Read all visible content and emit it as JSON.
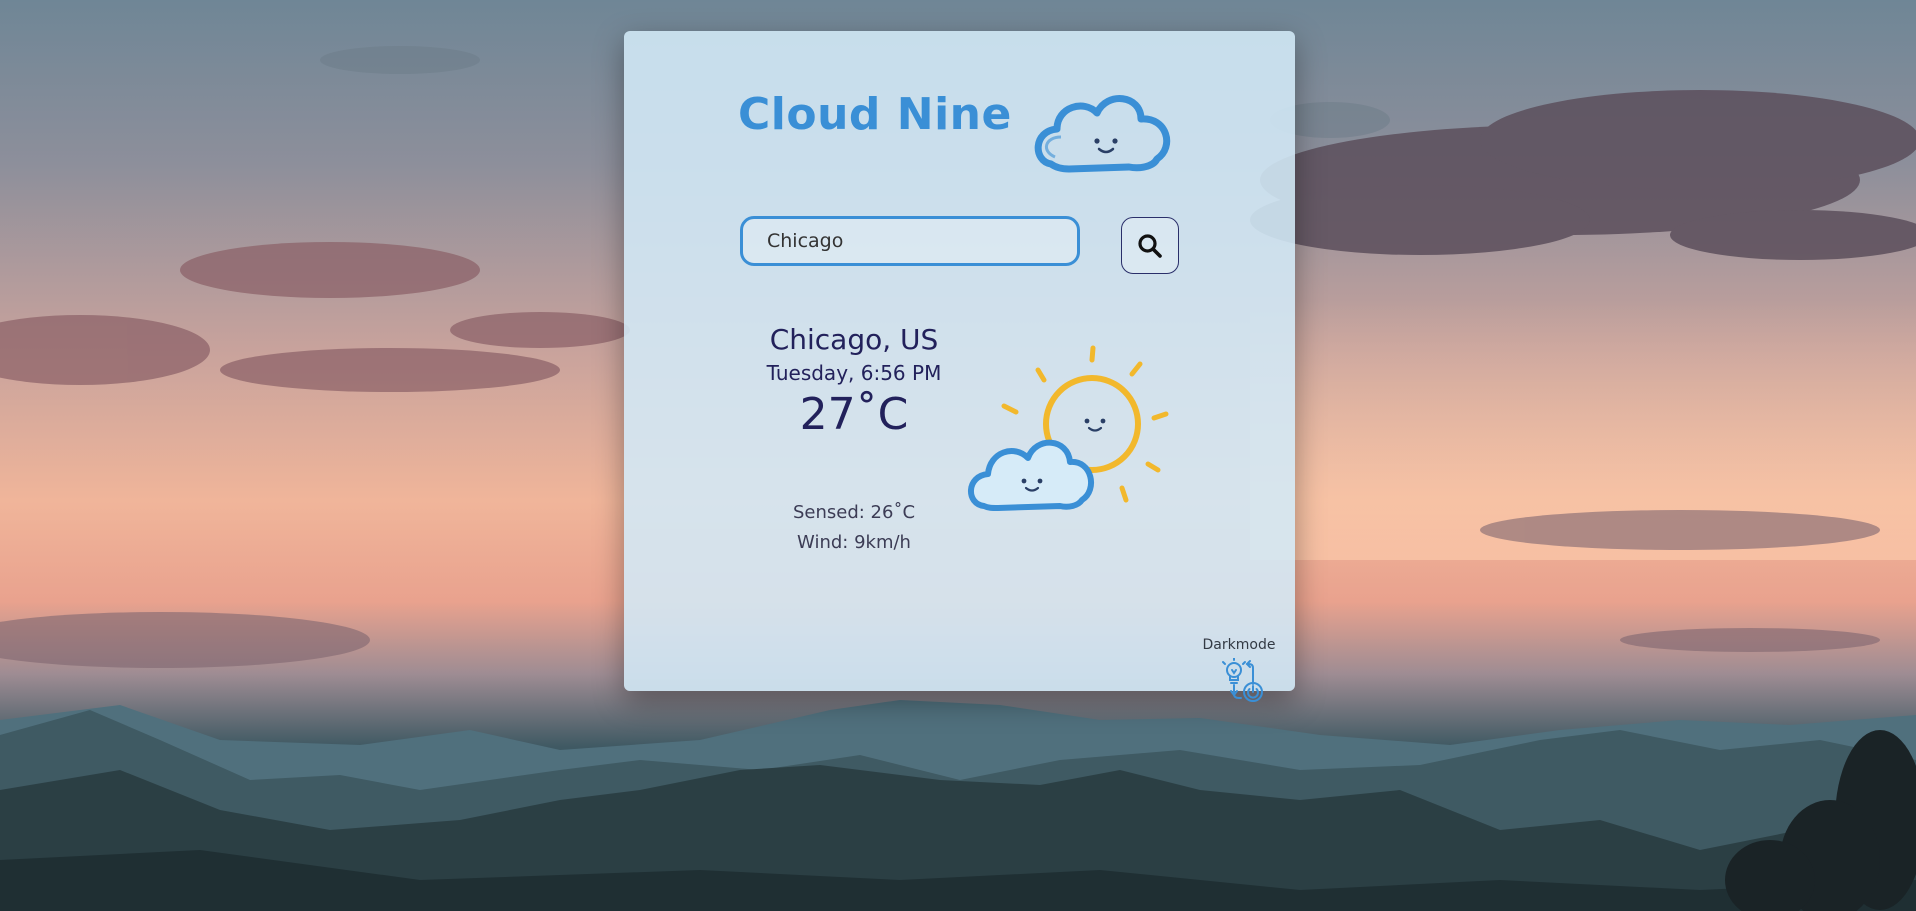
{
  "app": {
    "title": "Cloud Nine"
  },
  "search": {
    "value": "Chicago",
    "placeholder": ""
  },
  "weather": {
    "location": "Chicago, US",
    "datetime": "Tuesday, 6:56 PM",
    "temperature": "27˚C",
    "sensed": "Sensed: 26˚C",
    "wind": "Wind: 9km/h",
    "condition_icon": "partly-sunny-icon"
  },
  "darkmode": {
    "label": "Darkmode",
    "icon": "bulb-power-icon"
  },
  "colors": {
    "accent": "#3a8fd6",
    "text_dark": "#22215b",
    "sun": "#f2b82c",
    "card": "#d3e9f7"
  }
}
